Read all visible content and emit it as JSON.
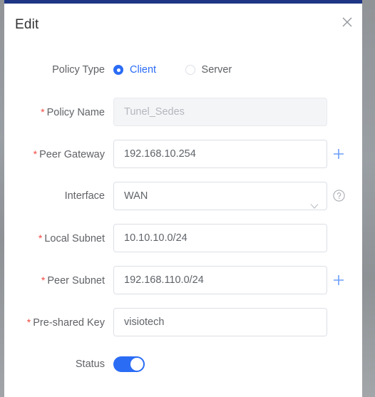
{
  "dialog": {
    "title": "Edit",
    "close_icon": "close-icon"
  },
  "form": {
    "rows": [
      {
        "id": "policy-type",
        "label": "Policy Type",
        "required": false,
        "type": "radio",
        "options": [
          {
            "label": "Client",
            "selected": true
          },
          {
            "label": "Server",
            "selected": false
          }
        ]
      },
      {
        "id": "policy-name",
        "label": "Policy Name",
        "required": true,
        "type": "text",
        "value": "Tunel_Sedes",
        "disabled": true
      },
      {
        "id": "peer-gateway",
        "label": "Peer Gateway",
        "required": true,
        "type": "text",
        "value": "192.168.10.254",
        "disabled": false,
        "trailing_icon": "plus-icon"
      },
      {
        "id": "interface",
        "label": "Interface",
        "required": false,
        "type": "select",
        "value": "WAN",
        "trailing_icon": "help-circle-icon"
      },
      {
        "id": "local-subnet",
        "label": "Local Subnet",
        "required": true,
        "type": "text",
        "value": "10.10.10.0/24",
        "disabled": false
      },
      {
        "id": "peer-subnet",
        "label": "Peer Subnet",
        "required": true,
        "type": "text",
        "value": "192.168.110.0/24",
        "disabled": false,
        "trailing_icon": "plus-icon"
      },
      {
        "id": "pre-shared-key",
        "label": "Pre-shared Key",
        "required": true,
        "type": "text",
        "value": "visiotech",
        "disabled": false
      },
      {
        "id": "status",
        "label": "Status",
        "required": false,
        "type": "switch",
        "enabled": true
      }
    ],
    "required_marker": "*"
  },
  "colors": {
    "accent_blue": "#2b6cf5",
    "topbar_navy": "#1f3684",
    "required_red": "#f04a41",
    "label_gray": "#606266",
    "border_gray": "#dcdfe6",
    "disabled_bg": "#f4f5f7"
  }
}
